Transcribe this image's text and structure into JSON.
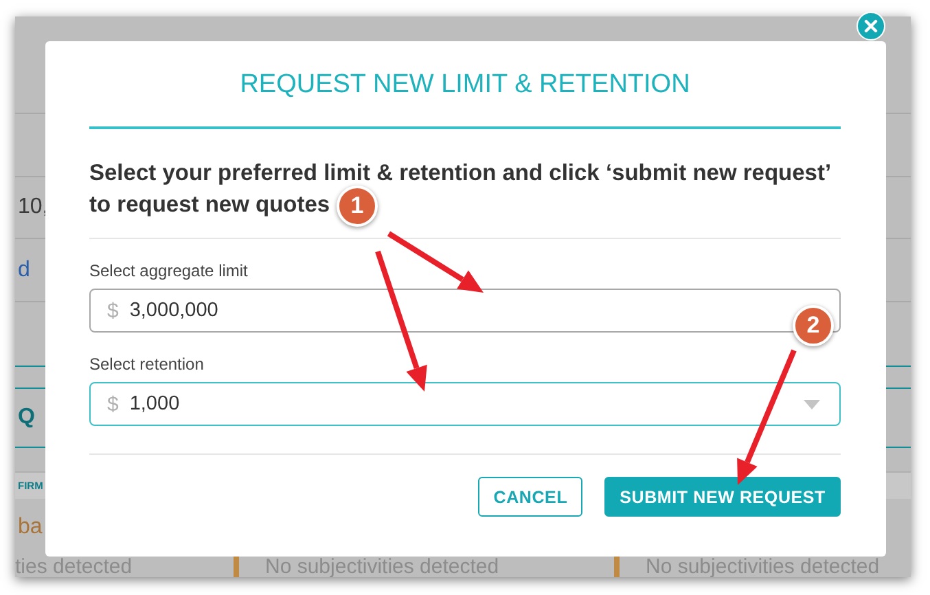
{
  "background": {
    "left_texts": [
      {
        "text": "10,",
        "kind": "amount"
      },
      {
        "text": "d",
        "kind": "link"
      },
      {
        "text": "Q",
        "kind": "heading"
      },
      {
        "text": "FIRM",
        "kind": "tab"
      },
      {
        "text": "ba",
        "kind": "status"
      }
    ],
    "bottom_texts": [
      "ties detected",
      "No subjectivities detected",
      "No subjectivities detected"
    ]
  },
  "modal": {
    "title": "REQUEST NEW LIMIT & RETENTION",
    "instruction": "Select your preferred limit & retention and click ‘submit new request’ to request new quotes",
    "fields": [
      {
        "label": "Select aggregate limit",
        "currency": "$",
        "value": "3,000,000",
        "focused": false,
        "caret": false
      },
      {
        "label": "Select retention",
        "currency": "$",
        "value": "1,000",
        "focused": true,
        "caret": true
      }
    ],
    "buttons": [
      {
        "label": "CANCEL",
        "kind": "secondary"
      },
      {
        "label": "SUBMIT NEW REQUEST",
        "kind": "primary"
      }
    ]
  },
  "annotations": [
    {
      "number": "1"
    },
    {
      "number": "2"
    }
  ]
}
